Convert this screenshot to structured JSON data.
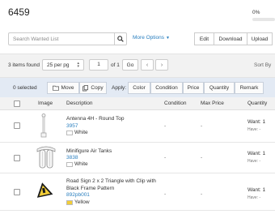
{
  "page": {
    "title": "6459",
    "progress_label": "0%",
    "progress_value": 0
  },
  "search": {
    "placeholder": "Search Wanted List",
    "more_label": "More Options"
  },
  "toolbar_buttons": {
    "edit": "Edit",
    "download": "Download",
    "upload": "Upload"
  },
  "pager": {
    "items_found": "3 items found",
    "per_page": "25 per pg",
    "current_page": "1",
    "of_label": "of 1",
    "go_label": "Go",
    "sort_label": "Sort By"
  },
  "actions": {
    "selected": "0 selected",
    "move": "Move",
    "copy": "Copy",
    "apply": "Apply:",
    "color": "Color",
    "condition": "Condition",
    "price": "Price",
    "quantity": "Quantity",
    "remark": "Remark"
  },
  "table": {
    "headers": {
      "image": "Image",
      "description": "Description",
      "condition": "Condition",
      "max_price": "Max Price",
      "quantity": "Quantity"
    },
    "rows": [
      {
        "name": "Antenna 4H - Round Top",
        "number": "3957",
        "color": "White",
        "color_hex": "#ffffff",
        "condition": "-",
        "max_price": "-",
        "want": "Want: 1",
        "have": "Have: -",
        "icon": "antenna-icon"
      },
      {
        "name": "Minifigure Air Tanks",
        "number": "3838",
        "color": "White",
        "color_hex": "#ffffff",
        "condition": "-",
        "max_price": "-",
        "want": "Want: 1",
        "have": "Have: -",
        "icon": "air-tanks-icon"
      },
      {
        "name": "Road Sign 2 x 2 Triangle with Clip with Black Frame Pattern",
        "name_line1": "Road Sign 2 x 2 Triangle with Clip with",
        "name_line2": "Black Frame Pattern",
        "number": "892pb001",
        "color": "Yellow",
        "color_hex": "#f2cd37",
        "condition": "-",
        "max_price": "-",
        "want": "Want: 1",
        "have": "Have: -",
        "icon": "road-sign-icon"
      }
    ]
  },
  "colors": {
    "accent": "#2a7fbf",
    "toolbar_bg": "#f2f2f2",
    "action_bar_bg": "#e3eaf4"
  }
}
